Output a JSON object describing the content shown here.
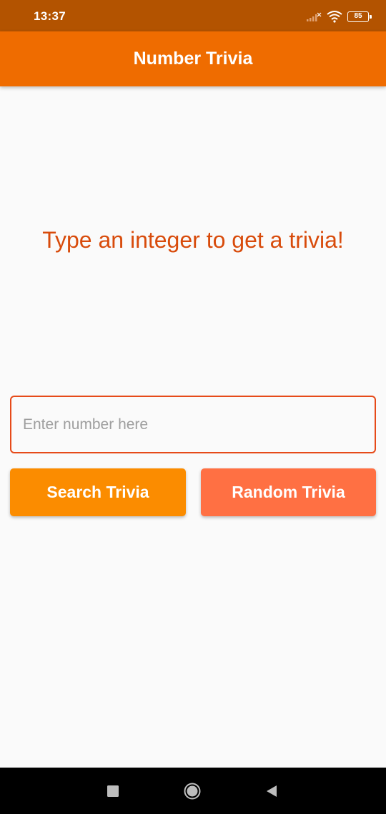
{
  "status_bar": {
    "time": "13:37",
    "battery_level": "85",
    "icons": [
      "signal-icon",
      "wifi-icon",
      "battery-icon"
    ]
  },
  "app_bar": {
    "title": "Number Trivia",
    "color": "#ef6c00"
  },
  "main": {
    "prompt": "Type an integer to get a trivia!",
    "input": {
      "value": "",
      "placeholder": "Enter number here"
    },
    "buttons": {
      "search_label": "Search Trivia",
      "random_label": "Random Trivia"
    }
  },
  "nav_bar": {
    "icons": [
      "recents-icon",
      "home-icon",
      "back-icon"
    ]
  },
  "colors": {
    "status_bar": "#b35300",
    "accent": "#ef6c00",
    "prompt_text": "#d84b0b",
    "input_border": "#e64a19",
    "search_button": "#fb8c00",
    "random_button": "#ff7043"
  }
}
